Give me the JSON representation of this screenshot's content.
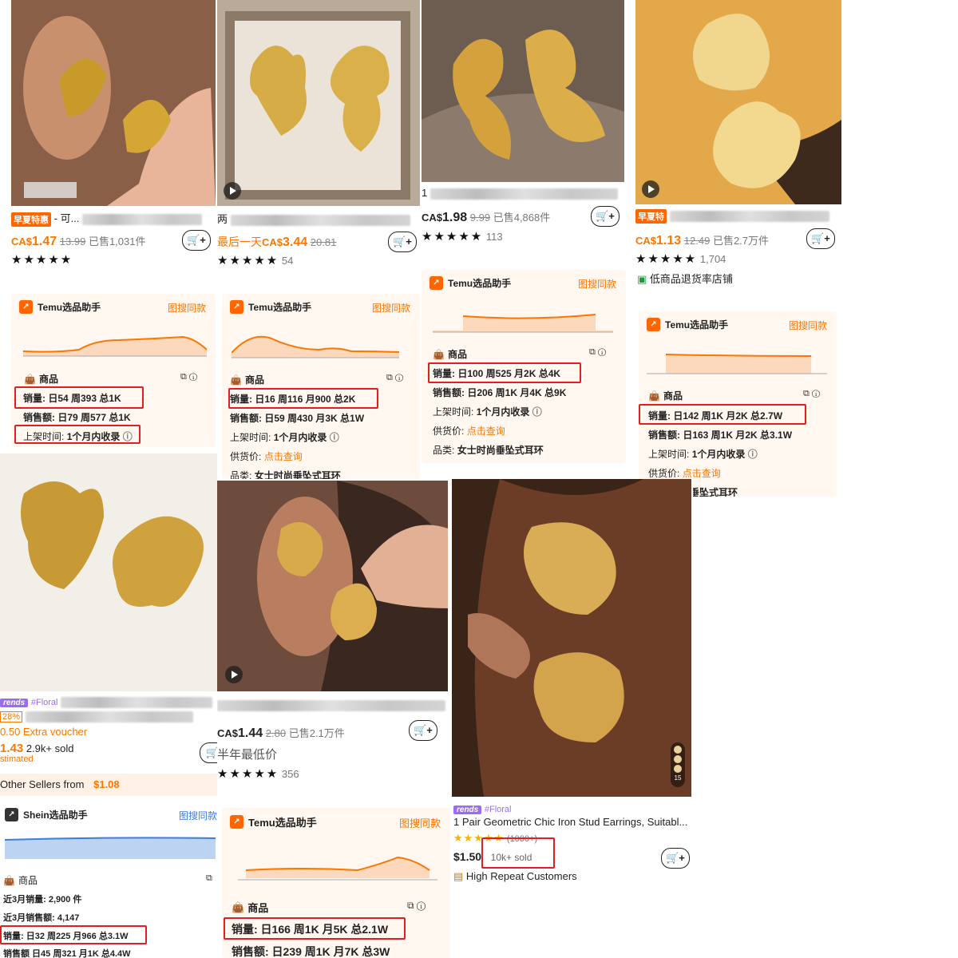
{
  "p1": {
    "badge": "早夏特惠",
    "title_tail": "- 可...",
    "price_currency": "CA$",
    "price": "1.47",
    "original": "13.99",
    "sold": "已售1,031件",
    "stars": "★★★★★",
    "helper": {
      "name": "Temu选品助手",
      "link": "图搜同款",
      "section": "商品",
      "sales": "销量: 日54 周393 总1K",
      "revenue": "销售额: 日79 周577 总1K",
      "listed_label": "上架时间:",
      "listed_value": "1个月内收录"
    }
  },
  "p2": {
    "title_head": "两",
    "promo": "最后一天",
    "price_currency": "CA$",
    "price": "3.44",
    "original": "20.81",
    "stars": "★★★★★",
    "rating_count": "54",
    "helper": {
      "name": "Temu选品助手",
      "link": "图搜同款",
      "section": "商品",
      "sales": "销量: 日16 周116 月900 总2K",
      "revenue": "销售额: 日59 周430 月3K 总1W",
      "listed_label": "上架时间:",
      "listed_value": "1个月内收录",
      "supply_label": "供货价:",
      "supply_link": "点击查询",
      "category_label": "品类:",
      "category_value": "女士时尚垂坠式耳环"
    }
  },
  "p3": {
    "title_head": "1",
    "price_currency": "CA$",
    "price": "1.98",
    "original": "9.99",
    "sold": "已售4,868件",
    "stars": "★★★★★",
    "rating_count": "113",
    "helper": {
      "name": "Temu选品助手",
      "link": "图搜同款",
      "section": "商品",
      "sales": "销量: 日100 周525 月2K 总4K",
      "revenue": "销售额: 日206 周1K 月4K 总9K",
      "listed_label": "上架时间:",
      "listed_value": "1个月内收录",
      "supply_label": "供货价:",
      "supply_link": "点击查询",
      "category_label": "品类:",
      "category_value": "女士时尚垂坠式耳环"
    }
  },
  "p4": {
    "badge": "早夏特",
    "price_currency": "CA$",
    "price": "1.13",
    "original": "12.49",
    "sold": "已售2.7万件",
    "stars": "★★★★★",
    "rating_count": "1,704",
    "store_note": "低商品退货率店铺",
    "helper": {
      "name": "Temu选品助手",
      "link": "图搜同款",
      "section": "商品",
      "sales": "销量: 日142 周1K 月2K 总2.7W",
      "revenue": "销售额: 日163 周1K 月2K 总3.1W",
      "listed_label": "上架时间:",
      "listed_value": "1个月内收录",
      "supply_label": "供货价:",
      "supply_link": "点击查询",
      "category_value": "垂坠式耳环"
    }
  },
  "p5": {
    "trends": "rends",
    "tag": "#Floral",
    "discount": "28%",
    "voucher": "0.50 Extra voucher",
    "price": "1.43",
    "sold": "2.9k+ sold",
    "estimated": "stimated",
    "sellers": "Other Sellers from",
    "sellers_price": "$1.08",
    "helper": {
      "name": "Shein选品助手",
      "link": "图搜同款",
      "section": "商品",
      "m3_sales": "近3月销量: 2,900 件",
      "m3_revenue": "近3月销售额: 4,147",
      "sales": "销量: 日32 周225 月966 总3.1W",
      "revenue": "销售额 日45 周321 月1K 总4.4W"
    }
  },
  "p6": {
    "price_currency": "CA$",
    "price": "1.44",
    "original": "2.80",
    "sold": "已售2.1万件",
    "promo": "半年最低价",
    "stars": "★★★★★",
    "rating_count": "356",
    "helper": {
      "name": "Temu选品助手",
      "link": "图搜同款",
      "section": "商品",
      "sales": "销量: 日166 周1K 月5K 总2.1W",
      "revenue": "销售额: 日239 周1K 月7K 总3W"
    }
  },
  "p7": {
    "trends": "rends",
    "tag": "#Floral",
    "title": "1 Pair Geometric Chic Iron Stud Earrings, Suitabl...",
    "stars": "★★★★★",
    "rating_count": "(1000+)",
    "price": "$1.50",
    "sold": "10k+ sold",
    "note": "High Repeat Customers",
    "photo_count": "15"
  },
  "colors": {
    "accent": "#fb7701",
    "highlight": "#e02020",
    "gold": "#d4a440",
    "trends": "#9c6cf0",
    "helper_bg": "#fff7f0"
  }
}
